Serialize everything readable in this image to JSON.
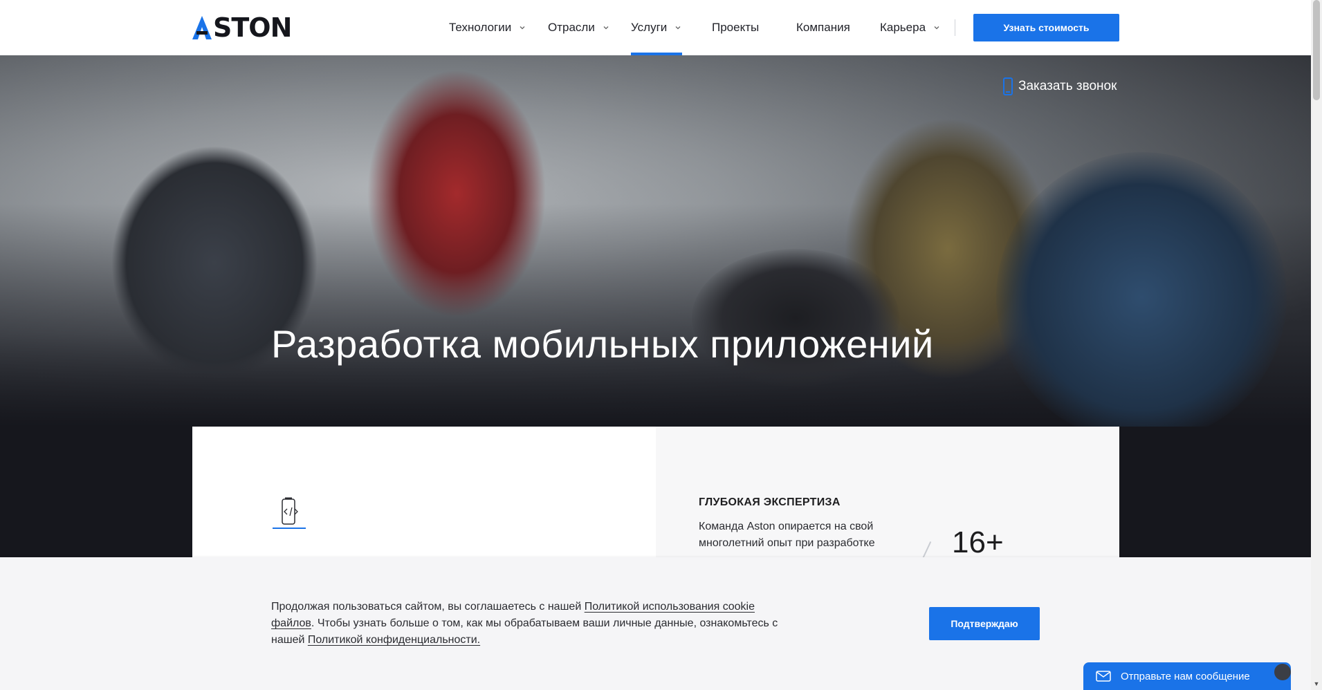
{
  "header": {
    "logo": "ASTON",
    "nav": [
      {
        "label": "Технологии",
        "dropdown": true
      },
      {
        "label": "Отрасли",
        "dropdown": true
      },
      {
        "label": "Услуги",
        "dropdown": true,
        "active": true
      },
      {
        "label": "Проекты",
        "dropdown": false
      },
      {
        "label": "Компания",
        "dropdown": false
      },
      {
        "label": "Карьера",
        "dropdown": true
      }
    ],
    "cta_label": "Узнать стоимость"
  },
  "hero": {
    "callback_label": "Заказать звонок",
    "title": "Разработка мобильных приложений"
  },
  "expertise": {
    "title": "ГЛУБОКАЯ ЭКСПЕРТИЗА",
    "text": "Команда Aston опирается на свой многолетний опыт при разработке",
    "number": "16+"
  },
  "cookie": {
    "text_1": "Продолжая пользоваться сайтом, вы соглашаетесь с нашей ",
    "link_1": "Политикой использования cookie файлов",
    "text_2": ". Чтобы узнать больше о том, как мы обрабатываем ваши личные данные, ознакомьтесь с нашей ",
    "link_2": "Политикой конфиденциальности.",
    "button_label": "Подтверждаю"
  },
  "chat": {
    "label": "Отправьте нам сообщение"
  },
  "icons": {
    "logo_mark": "aston-logo-a",
    "callback": "phone-icon",
    "service": "mobile-code-icon",
    "chat": "mail-icon",
    "dropdown": "chevron-down-icon"
  },
  "colors": {
    "accent": "#1a73e8",
    "dark": "#16171d"
  }
}
